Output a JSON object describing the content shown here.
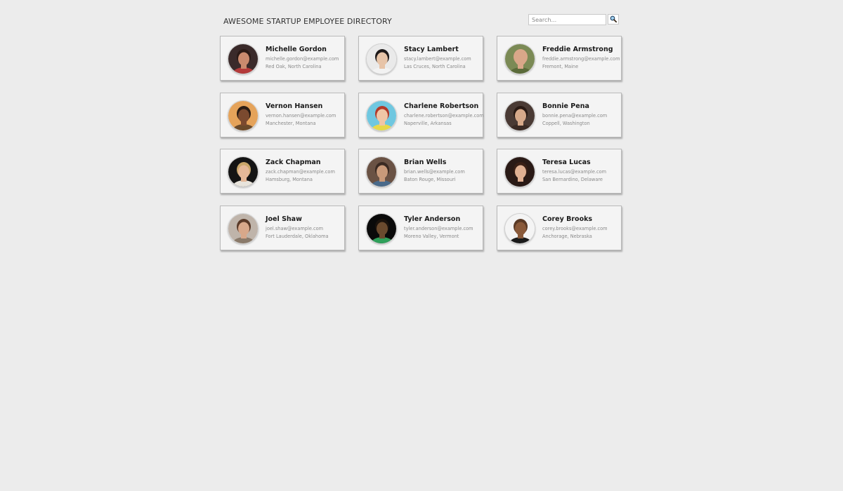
{
  "header": {
    "title": "AWESOME STARTUP EMPLOYEE DIRECTORY",
    "search_placeholder": "Search...",
    "search_icon": "magnifier-icon"
  },
  "employees": [
    {
      "name": "Michelle Gordon",
      "email": "michelle.gordon@example.com",
      "location": "Red Oak, North Carolina",
      "bg": "#3a2a2a",
      "skin": "#c98a6e",
      "hair": "#2b1a16",
      "shirt": "#b43a3a"
    },
    {
      "name": "Stacy Lambert",
      "email": "stacy.lambert@example.com",
      "location": "Las Cruces, North Carolina",
      "bg": "#eaeaea",
      "skin": "#e7c4a8",
      "hair": "#1f1a1a",
      "shirt": "#f2f2f2"
    },
    {
      "name": "Freddie Armstrong",
      "email": "freddie.armstrong@example.com",
      "location": "Fremont, Maine",
      "bg": "#7b8a55",
      "skin": "#d9a789",
      "hair": "#d9a789",
      "shirt": "#5b6b3a"
    },
    {
      "name": "Vernon Hansen",
      "email": "vernon.hansen@example.com",
      "location": "Manchester, Montana",
      "bg": "#e5a35a",
      "skin": "#7b4a2f",
      "hair": "#2a1c14",
      "shirt": "#6a4a2a"
    },
    {
      "name": "Charlene Robertson",
      "email": "charlene.robertson@example.com",
      "location": "Naperville, Arkansas",
      "bg": "#6fc7e0",
      "skin": "#f0c6a6",
      "hair": "#b23a2a",
      "shirt": "#e8d84a"
    },
    {
      "name": "Bonnie Pena",
      "email": "bonnie.pena@example.com",
      "location": "Coppell, Washington",
      "bg": "#4a3a34",
      "skin": "#d7a98a",
      "hair": "#2a1a14",
      "shirt": "#3a2a24"
    },
    {
      "name": "Zack Chapman",
      "email": "zack.chapman@example.com",
      "location": "Hamsburg, Montana",
      "bg": "#141414",
      "skin": "#e4b898",
      "hair": "#c9a66a",
      "shirt": "#e8e4dc"
    },
    {
      "name": "Brian Wells",
      "email": "brian.wells@example.com",
      "location": "Baton Rouge, Missouri",
      "bg": "#6a5244",
      "skin": "#c99a7a",
      "hair": "#3a2a22",
      "shirt": "#4a6a8a"
    },
    {
      "name": "Teresa Lucas",
      "email": "teresa.lucas@example.com",
      "location": "San Bernardino, Delaware",
      "bg": "#2a1a16",
      "skin": "#e0b092",
      "hair": "#3a2016",
      "shirt": "#2a1a16"
    },
    {
      "name": "Joel Shaw",
      "email": "joel.shaw@example.com",
      "location": "Fort Lauderdale, Oklahoma",
      "bg": "#bfb4aa",
      "skin": "#d8a88a",
      "hair": "#5a3a28",
      "shirt": "#8a7a6a"
    },
    {
      "name": "Tyler Anderson",
      "email": "tyler.anderson@example.com",
      "location": "Moreno Valley, Vermont",
      "bg": "#0a0a0a",
      "skin": "#6a4a2e",
      "hair": "#1a120c",
      "shirt": "#2fa05a"
    },
    {
      "name": "Corey Brooks",
      "email": "corey.brooks@example.com",
      "location": "Anchorage, Nebraska",
      "bg": "#f4f4f4",
      "skin": "#8a5a3a",
      "hair": "#5a3a26",
      "shirt": "#1a1a1a"
    }
  ]
}
